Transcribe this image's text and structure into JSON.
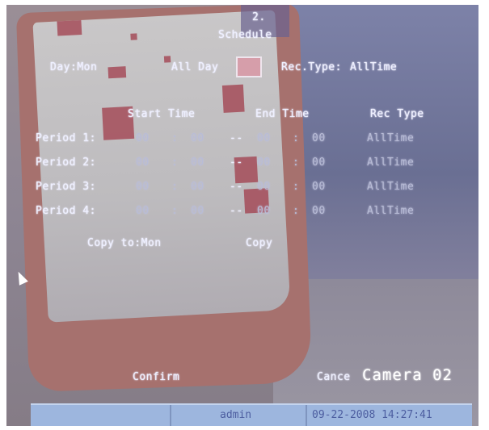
{
  "page_number": "2.",
  "title": "Schedule",
  "day": {
    "label": "Day:",
    "value": "Mon"
  },
  "all_day": {
    "label": "All Day"
  },
  "rec_type": {
    "label": "Rec.Type:",
    "value": "AllTime"
  },
  "table": {
    "columns": [
      "Start Time",
      "End Time",
      "Rec Type"
    ],
    "rows": [
      {
        "label": "Period 1:",
        "start_h": "00",
        "start_sep": ":",
        "start_m": "00",
        "dash": "--",
        "end_h": "00",
        "end_sep": ":",
        "end_m": "00",
        "type": "AllTime"
      },
      {
        "label": "Period 2:",
        "start_h": "00",
        "start_sep": ":",
        "start_m": "00",
        "dash": "--",
        "end_h": "00",
        "end_sep": ":",
        "end_m": "00",
        "type": "AllTime"
      },
      {
        "label": "Period 3:",
        "start_h": "00",
        "start_sep": ":",
        "start_m": "00",
        "dash": "--",
        "end_h": "00",
        "end_sep": ":",
        "end_m": "00",
        "type": "AllTime"
      },
      {
        "label": "Period 4:",
        "start_h": "00",
        "start_sep": ":",
        "start_m": "00",
        "dash": "--",
        "end_h": "00",
        "end_sep": ":",
        "end_m": "00",
        "type": "AllTime"
      }
    ]
  },
  "copy_to": {
    "label": "Copy to:",
    "value": "Mon"
  },
  "copy_button": "Copy",
  "confirm_button": "Confirm",
  "cancel_button": "Cance",
  "camera_name": "Camera 02",
  "status_bar": {
    "user": "admin",
    "datetime": "09-22-2008 14:27:41"
  },
  "colors": {
    "osd_text": "#eef0ff",
    "status_bar": "#9db6de",
    "status_text": "#4d5ea0",
    "selection": "#d89aa8"
  }
}
